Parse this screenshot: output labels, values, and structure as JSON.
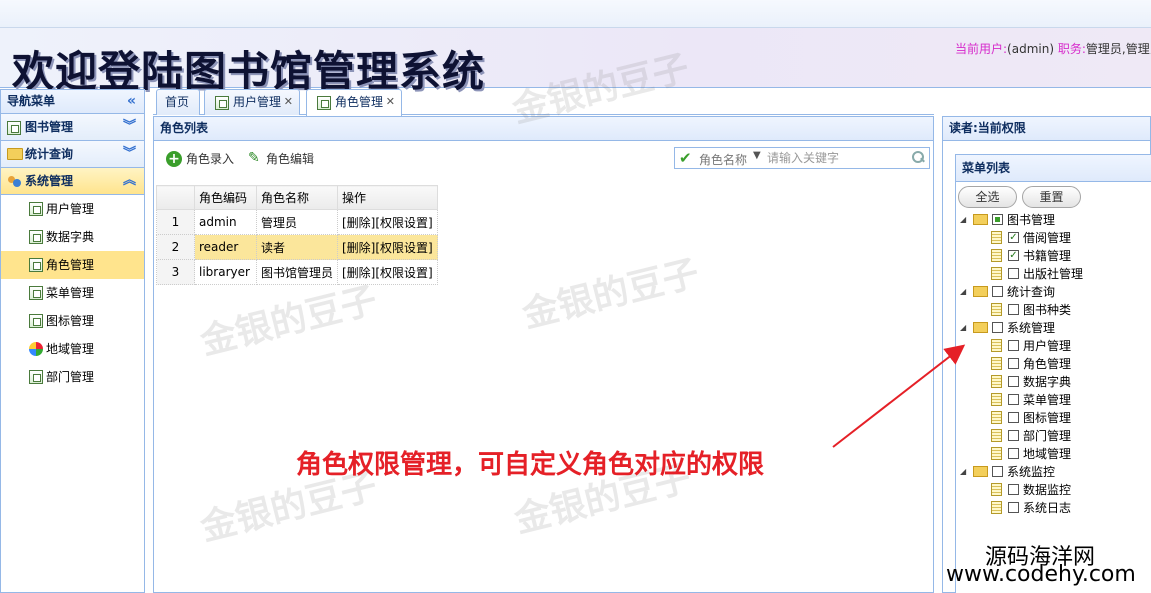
{
  "header": {
    "title": "欢迎登陆图书馆管理系统",
    "user_label": "当前用户:",
    "user_value": "(admin)",
    "role_label": "职务:",
    "role_value": "管理员,管理员"
  },
  "left_nav": {
    "title": "导航菜单",
    "sections": [
      {
        "label": "图书管理"
      },
      {
        "label": "统计查询"
      },
      {
        "label": "系统管理"
      }
    ],
    "items": [
      {
        "label": "用户管理"
      },
      {
        "label": "数据字典"
      },
      {
        "label": "角色管理"
      },
      {
        "label": "菜单管理"
      },
      {
        "label": "图标管理"
      },
      {
        "label": "地域管理"
      },
      {
        "label": "部门管理"
      }
    ]
  },
  "tabs": [
    {
      "label": "首页"
    },
    {
      "label": "用户管理"
    },
    {
      "label": "角色管理"
    }
  ],
  "role_panel": {
    "title": "角色列表",
    "add_label": "角色录入",
    "edit_label": "角色编辑",
    "search_field": "角色名称",
    "search_placeholder": "请输入关键字",
    "columns": [
      "角色编码",
      "角色名称",
      "操作"
    ],
    "rows": [
      {
        "num": "1",
        "code": "admin",
        "name": "管理员",
        "ops": "[删除][权限设置]"
      },
      {
        "num": "2",
        "code": "reader",
        "name": "读者",
        "ops": "[删除][权限设置]"
      },
      {
        "num": "3",
        "code": "libraryer",
        "name": "图书馆管理员",
        "ops": "[删除][权限设置]"
      }
    ]
  },
  "perm_panel": {
    "title": "读者:当前权限",
    "menu_title": "菜单列表",
    "select_all": "全选",
    "reset": "重置",
    "tree": [
      {
        "label": "图书管理",
        "children": [
          {
            "label": "借阅管理",
            "checked": true
          },
          {
            "label": "书籍管理",
            "checked": true
          },
          {
            "label": "出版社管理",
            "checked": false
          }
        ]
      },
      {
        "label": "统计查询",
        "children": [
          {
            "label": "图书种类",
            "checked": false
          }
        ]
      },
      {
        "label": "系统管理",
        "children": [
          {
            "label": "用户管理",
            "checked": false
          },
          {
            "label": "角色管理",
            "checked": false
          },
          {
            "label": "数据字典",
            "checked": false
          },
          {
            "label": "菜单管理",
            "checked": false
          },
          {
            "label": "图标管理",
            "checked": false
          },
          {
            "label": "部门管理",
            "checked": false
          },
          {
            "label": "地域管理",
            "checked": false
          }
        ]
      },
      {
        "label": "系统监控",
        "children": [
          {
            "label": "数据监控",
            "checked": false
          },
          {
            "label": "系统日志",
            "checked": false
          }
        ]
      }
    ]
  },
  "overlay": {
    "annotation": "角色权限管理，可自定义角色对应的权限",
    "watermark": "金银的豆子",
    "site_cn": "源码海洋网",
    "site_url": "www.codehy.com"
  },
  "colors": {
    "accent_border": "#95b8e7",
    "selected": "#ffe48d",
    "annotation": "#e52027"
  }
}
